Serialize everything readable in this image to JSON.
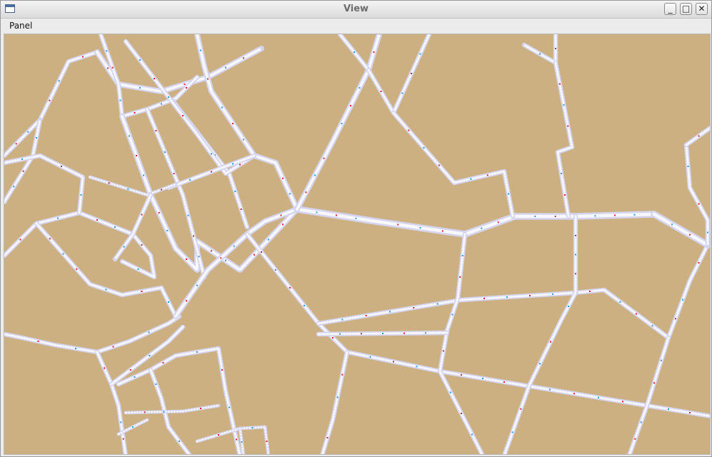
{
  "window": {
    "title": "View",
    "app_icon": "window-icon",
    "controls": {
      "minimize": "_",
      "maximize": "□",
      "close": "✕"
    }
  },
  "menubar": {
    "items": [
      {
        "label": "Panel"
      }
    ]
  },
  "map": {
    "background_color": "#cdb082",
    "road_color": "#d4d4ee",
    "marker_colors": [
      "#e02030",
      "#20a0e0"
    ]
  }
}
